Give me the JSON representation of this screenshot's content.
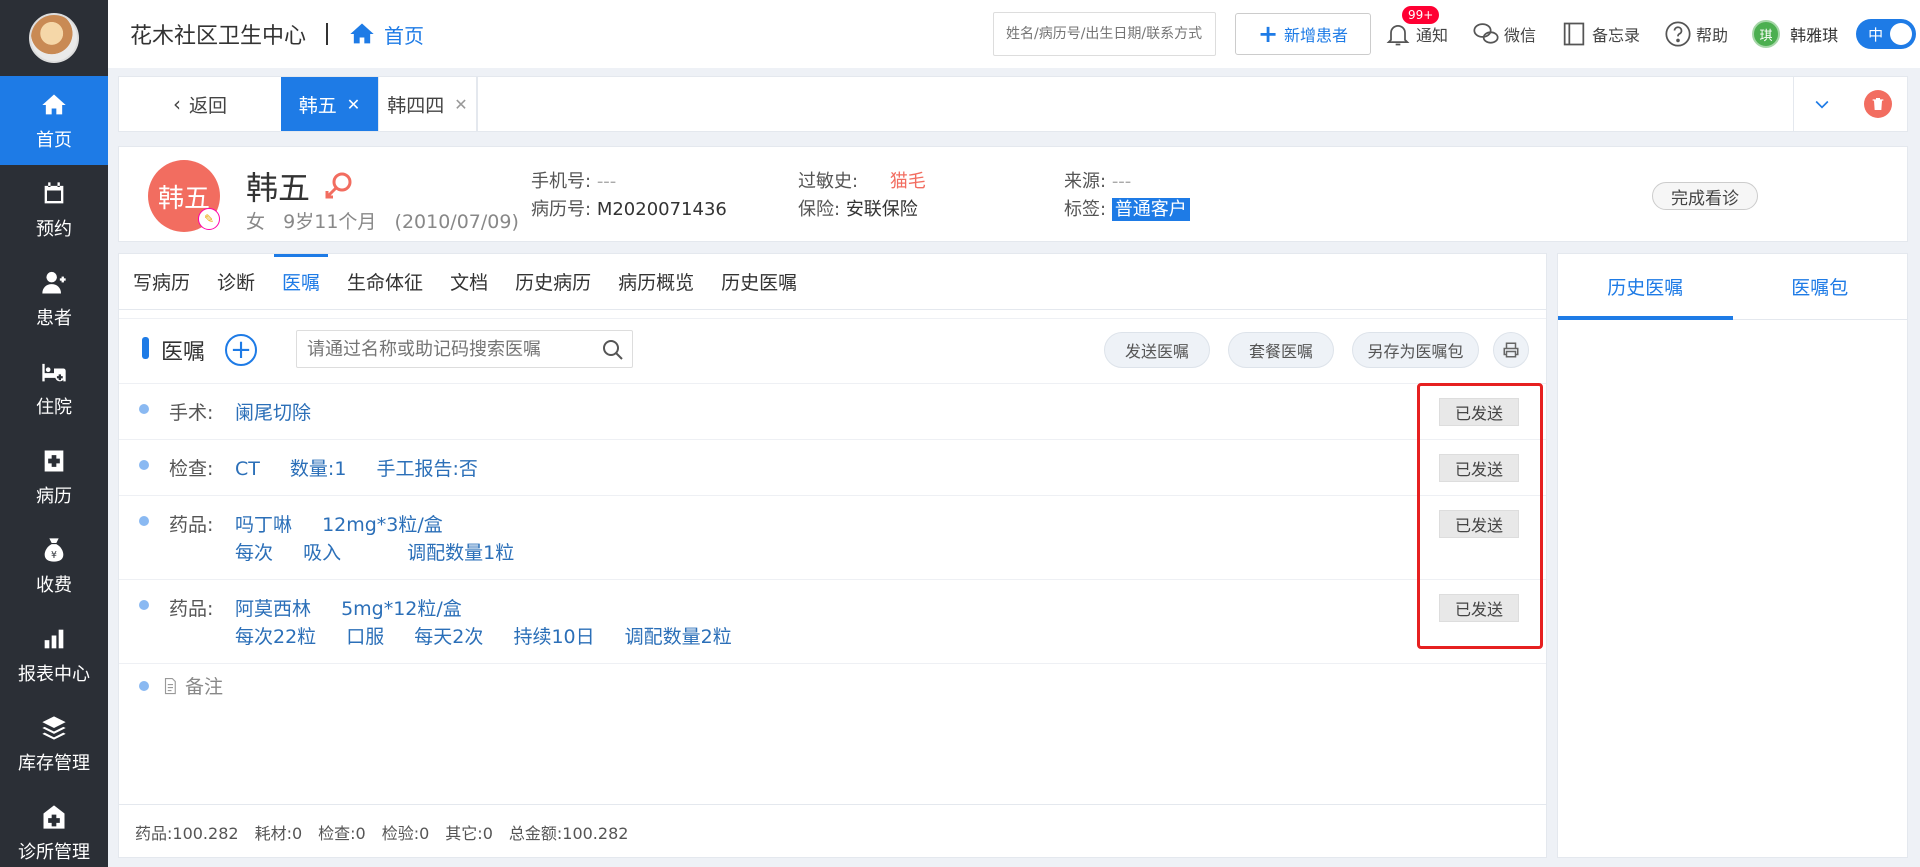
{
  "sidebar": {
    "items": [
      {
        "label": "首页",
        "icon": "home-icon",
        "active": true
      },
      {
        "label": "预约",
        "icon": "calendar-icon"
      },
      {
        "label": "患者",
        "icon": "patient-icon"
      },
      {
        "label": "住院",
        "icon": "bed-icon"
      },
      {
        "label": "病历",
        "icon": "medical-record-icon"
      },
      {
        "label": "收费",
        "icon": "money-bag-icon"
      },
      {
        "label": "报表中心",
        "icon": "bar-chart-icon"
      },
      {
        "label": "库存管理",
        "icon": "layers-icon"
      },
      {
        "label": "诊所管理",
        "icon": "clinic-icon"
      }
    ]
  },
  "topbar": {
    "clinic_name": "花木社区卫生中心",
    "home_label": "首页",
    "search_placeholder": "姓名/病历号/出生日期/联系方式",
    "new_patient_label": "新增患者",
    "notify_label": "通知",
    "notify_badge": "99+",
    "wechat_label": "微信",
    "memo_label": "备忘录",
    "help_label": "帮助",
    "user_initial": "琪",
    "user_name": "韩雅琪",
    "lang_label": "中"
  },
  "tabbar": {
    "back_label": "返回",
    "tabs": [
      {
        "label": "韩五",
        "active": true
      },
      {
        "label": "韩四四",
        "active": false
      }
    ]
  },
  "patient": {
    "avatar_text": "韩五",
    "name": "韩五",
    "gender": "女",
    "age": "9岁11个月",
    "birth": "(2010/07/09)",
    "phone_label": "手机号:",
    "phone_value": "---",
    "record_label": "病历号:",
    "record_value": "M2020071436",
    "allergy_label": "过敏史:",
    "allergy_value": "猫毛",
    "insurance_label": "保险:",
    "insurance_value": "安联保险",
    "source_label": "来源:",
    "source_value": "---",
    "tag_label": "标签:",
    "tag_value": "普通客户",
    "finish_label": "完成看诊"
  },
  "subtabs": [
    "写病历",
    "诊断",
    "医嘱",
    "生命体征",
    "文档",
    "历史病历",
    "病历概览",
    "历史医嘱"
  ],
  "subtab_active": 2,
  "orders": {
    "title": "医嘱",
    "search_placeholder": "请通过名称或助记码搜索医嘱",
    "send_label": "发送医嘱",
    "package_label": "套餐医嘱",
    "save_package_label": "另存为医嘱包",
    "rows": [
      {
        "kind": "手术:",
        "line1": [
          "阑尾切除"
        ],
        "line2": [],
        "status": "已发送"
      },
      {
        "kind": "检查:",
        "line1": [
          "CT",
          "数量:1",
          "手工报告:否"
        ],
        "line2": [],
        "status": "已发送"
      },
      {
        "kind": "药品:",
        "line1": [
          "吗丁啉",
          "12mg*3粒/盒"
        ],
        "line2": [
          "每次",
          "吸入",
          "调配数量1粒"
        ],
        "status": "已发送"
      },
      {
        "kind": "药品:",
        "line1": [
          "阿莫西林",
          "5mg*12粒/盒"
        ],
        "line2": [
          "每次22粒",
          "口服",
          "每天2次",
          "持续10日",
          "调配数量2粒"
        ],
        "status": "已发送"
      }
    ],
    "note_label": "备注"
  },
  "summary": {
    "drug": "药品:100.282",
    "material": "耗材:0",
    "exam": "检查:0",
    "test": "检验:0",
    "other": "其它:0",
    "total": "总金额:100.282"
  },
  "side": {
    "tab_history": "历史医嘱",
    "tab_package": "医嘱包"
  },
  "colors": {
    "primary": "#1e7be6",
    "sidebar_bg": "#2b2f36",
    "avatar_bg": "#f26d60",
    "highlight": "#e62020"
  }
}
